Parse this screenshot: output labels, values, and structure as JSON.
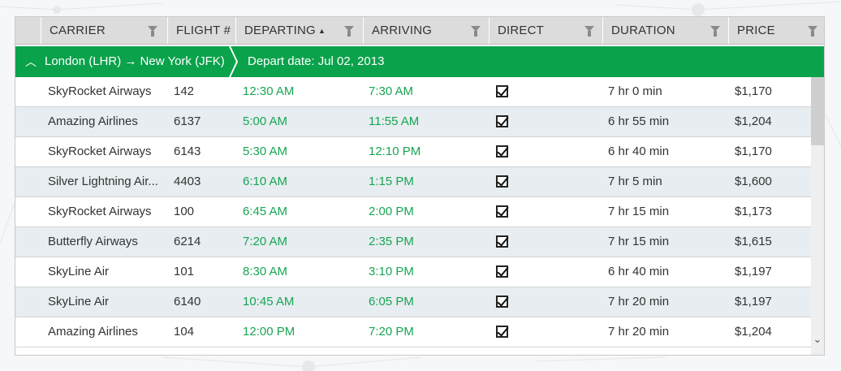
{
  "grid": {
    "columns": [
      {
        "label": "CARRIER",
        "name": "carrier"
      },
      {
        "label": "FLIGHT #",
        "name": "flight"
      },
      {
        "label": "DEPARTING",
        "name": "departing",
        "sorted": "ascending"
      },
      {
        "label": "ARRIVING",
        "name": "arriving"
      },
      {
        "label": "DIRECT",
        "name": "direct"
      },
      {
        "label": "DURATION",
        "name": "duration"
      },
      {
        "label": "PRICE",
        "name": "price"
      }
    ],
    "sort_indicator": "▲",
    "group": {
      "route": "London (LHR) → New York (JFK)",
      "date": "Depart date: Jul 02, 2013",
      "expanded": true
    },
    "rows": [
      {
        "carrier": "SkyRocket Airways",
        "flight": "142",
        "departing": "12:30 AM",
        "arriving": "7:30 AM",
        "direct": true,
        "duration": "7 hr 0 min",
        "price": "$1,170"
      },
      {
        "carrier": "Amazing Airlines",
        "flight": "6137",
        "departing": "5:00 AM",
        "arriving": "11:55 AM",
        "direct": true,
        "duration": "6 hr 55 min",
        "price": "$1,204"
      },
      {
        "carrier": "SkyRocket Airways",
        "flight": "6143",
        "departing": "5:30 AM",
        "arriving": "12:10 PM",
        "direct": true,
        "duration": "6 hr 40 min",
        "price": "$1,170"
      },
      {
        "carrier": "Silver Lightning Air...",
        "flight": "4403",
        "departing": "6:10 AM",
        "arriving": "1:15 PM",
        "direct": true,
        "duration": "7 hr 5 min",
        "price": "$1,600"
      },
      {
        "carrier": "SkyRocket Airways",
        "flight": "100",
        "departing": "6:45 AM",
        "arriving": "2:00 PM",
        "direct": true,
        "duration": "7 hr 15 min",
        "price": "$1,173"
      },
      {
        "carrier": "Butterfly Airways",
        "flight": "6214",
        "departing": "7:20 AM",
        "arriving": "2:35 PM",
        "direct": true,
        "duration": "7 hr 15 min",
        "price": "$1,615"
      },
      {
        "carrier": "SkyLine Air",
        "flight": "101",
        "departing": "8:30 AM",
        "arriving": "3:10 PM",
        "direct": true,
        "duration": "6 hr 40 min",
        "price": "$1,197"
      },
      {
        "carrier": "SkyLine Air",
        "flight": "6140",
        "departing": "10:45 AM",
        "arriving": "6:05 PM",
        "direct": true,
        "duration": "7 hr 20 min",
        "price": "$1,197"
      },
      {
        "carrier": "Amazing Airlines",
        "flight": "104",
        "departing": "12:00 PM",
        "arriving": "7:20 PM",
        "direct": true,
        "duration": "7 hr 20 min",
        "price": "$1,204"
      }
    ]
  },
  "colors": {
    "group_header": "#0aa24b",
    "time_text": "#17a553",
    "alt_row": "#e7edf0",
    "header_bg": "#dcdcdc"
  },
  "icons": {
    "filter": "funnel-icon",
    "collapse": "chevron-up-icon",
    "checkbox": "checkbox-checked-icon",
    "scroll_down": "chevron-down-icon"
  }
}
